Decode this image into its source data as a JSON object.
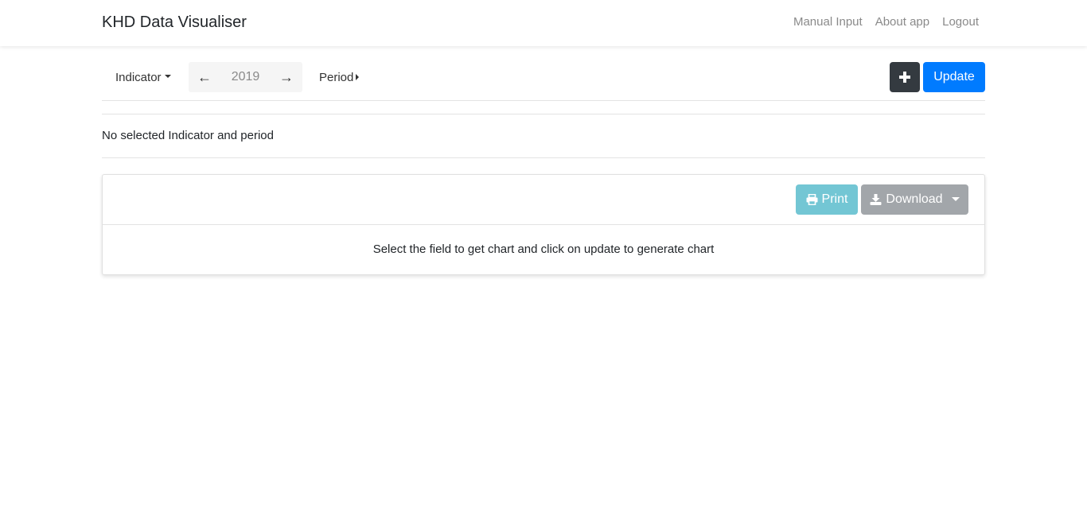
{
  "app": {
    "brand": "KHD Data Visualiser"
  },
  "nav": {
    "items": [
      {
        "label": "Manual Input"
      },
      {
        "label": "About app"
      },
      {
        "label": "Logout"
      }
    ]
  },
  "toolbar": {
    "indicator_label": "Indicator",
    "year_prev": "←",
    "year_value": "2019",
    "year_next": "→",
    "period_label": "Period",
    "add_label": "+",
    "update_label": "Update"
  },
  "info": {
    "selection_status": "No selected Indicator and period"
  },
  "card": {
    "print_label": "Print",
    "download_label": "Download",
    "empty_message": "Select the field to get chart and click on update to generate chart"
  },
  "colors": {
    "primary": "#007bff",
    "dark": "#343a40",
    "info": "#73c6d4",
    "secondary": "#a2a6aa"
  }
}
